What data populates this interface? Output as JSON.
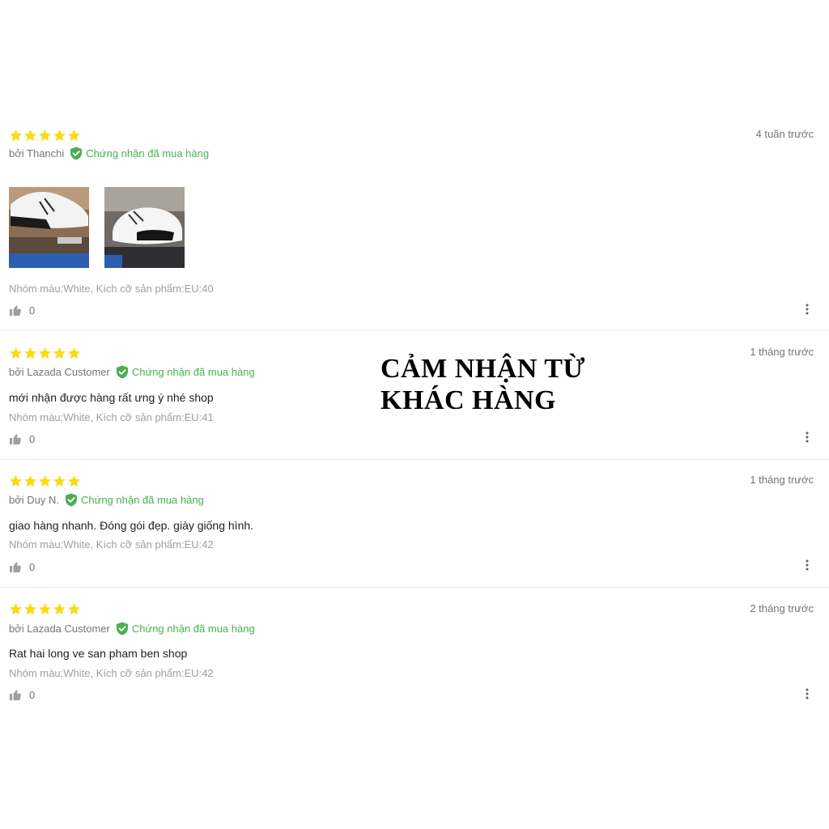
{
  "reviews": [
    {
      "rating": 5,
      "date": "4 tuần trước",
      "author": "bởi Thanchi",
      "verified_label": "Chứng nhận đã mua hàng",
      "content": "",
      "photos": [
        "shoe-photo-1",
        "shoe-photo-2"
      ],
      "sku": "Nhóm màu:White, Kích cỡ sản phẩm:EU:40",
      "likes": "0"
    },
    {
      "rating": 5,
      "date": "1 tháng trước",
      "author": "bởi Lazada Customer",
      "verified_label": "Chứng nhận đã mua hàng",
      "content": "mới nhận được hàng rất ưng ý nhé shop",
      "sku": "Nhóm màu:White, Kích cỡ sản phẩm:EU:41",
      "likes": "0"
    },
    {
      "rating": 5,
      "date": "1 tháng trước",
      "author": "bởi Duy N.",
      "verified_label": "Chứng nhận đã mua hàng",
      "content": "giao hàng nhanh. Đóng gói đẹp. giày giống hình.",
      "sku": "Nhóm màu:White, Kích cỡ sản phẩm:EU:42",
      "likes": "0"
    },
    {
      "rating": 5,
      "date": "2 tháng trước",
      "author": "bởi Lazada Customer",
      "verified_label": "Chứng nhận đã mua hàng",
      "content": "Rat hai long ve san pham ben shop",
      "sku": "Nhóm màu:White, Kích cỡ sản phẩm:EU:42",
      "likes": "0"
    }
  ],
  "overlay": {
    "line1": "CẢM NHẬN TỪ",
    "line2": "KHÁC HÀNG"
  },
  "icons": {
    "star": "star-icon",
    "verified": "verified-shield-icon",
    "like": "thumbs-up-icon",
    "more": "more-vertical-icon"
  },
  "colors": {
    "star": "#fadb14",
    "verified": "#4caf50",
    "muted": "#757575",
    "sku": "#9e9e9e"
  }
}
